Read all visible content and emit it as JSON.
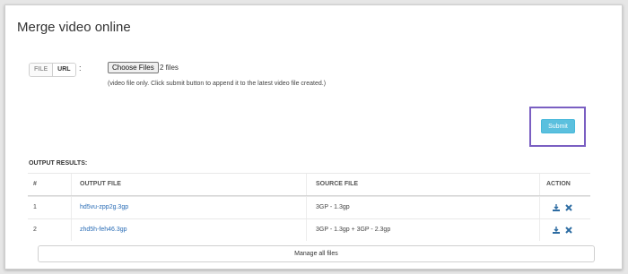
{
  "page": {
    "title": "Merge video online"
  },
  "source_toggle": {
    "file_label": "FILE",
    "url_label": "URL",
    "colon": ":"
  },
  "file_input": {
    "button_label": "Choose Files",
    "selected_text": "2 files"
  },
  "hint": "(video file only. Click submit button to append it to the latest video file created.)",
  "submit": {
    "label": "Submit"
  },
  "output": {
    "label": "OUTPUT RESULTS:",
    "columns": [
      "#",
      "OUTPUT FILE",
      "SOURCE FILE",
      "ACTION"
    ],
    "rows": [
      {
        "num": "1",
        "output_file": "hd5vu-zpp2g.3gp",
        "source_file": "3GP - 1.3gp"
      },
      {
        "num": "2",
        "output_file": "zhd5h-feh46.3gp",
        "source_file": "3GP - 1.3gp + 3GP - 2.3gp"
      }
    ]
  },
  "manage": {
    "label": "Manage all files"
  },
  "colors": {
    "accent": "#5bc0de",
    "link": "#2a6db6",
    "highlight": "#7a5fc2",
    "icon": "#2d6ca2"
  },
  "icons": {
    "download": "download-icon",
    "delete": "close-icon"
  }
}
